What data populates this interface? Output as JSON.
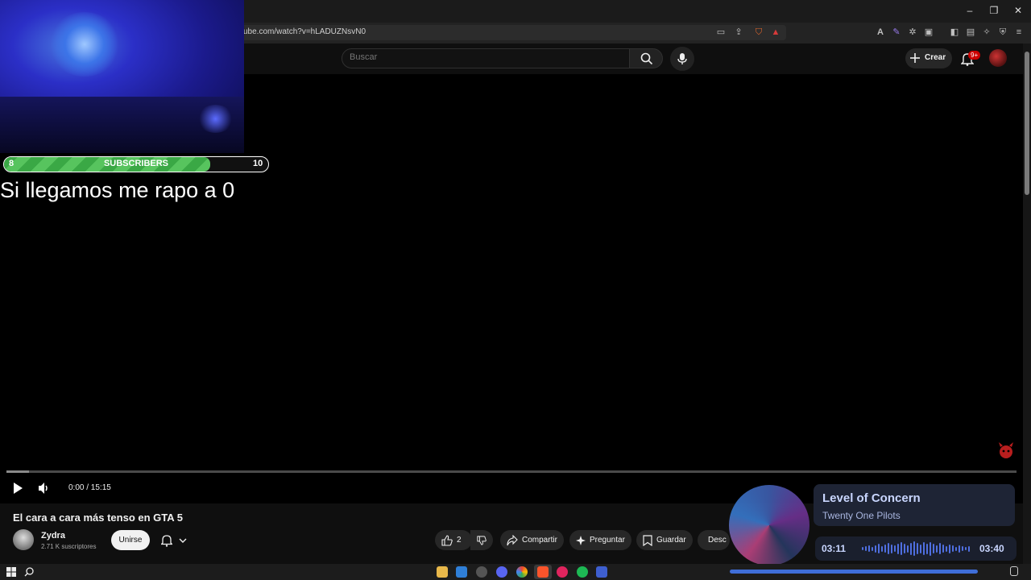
{
  "browser": {
    "url": "ube.com/watch?v=hLADUZNsvN0"
  },
  "header": {
    "search_placeholder": "Buscar",
    "create_label": "Crear",
    "notification_badge": "9+"
  },
  "overlay": {
    "sub_goal": {
      "min": "8",
      "label": "SUBSCRIBERS",
      "max": "10",
      "fill_fraction": 0.78
    },
    "caption": "Si llegamos me rapo a 0"
  },
  "player": {
    "timecode": "0:00 / 15:15",
    "played_fraction": 0.022
  },
  "video": {
    "title": "El cara a cara más tenso en GTA 5",
    "channel_name": "Zydra",
    "channel_subs": "2.71 K suscriptores",
    "join_label": "Unirse",
    "likes": "2",
    "share_label": "Compartir",
    "ask_label": "Preguntar",
    "save_label": "Guardar",
    "download_label": "Desc"
  },
  "music": {
    "song_title": "Level of Concern",
    "artist": "Twenty One Pilots",
    "elapsed": "03:11",
    "total": "03:40"
  },
  "colors": {
    "accent_green": "#3aa845",
    "music_accent": "#4f6fe0",
    "yt_red": "#cc0000"
  }
}
